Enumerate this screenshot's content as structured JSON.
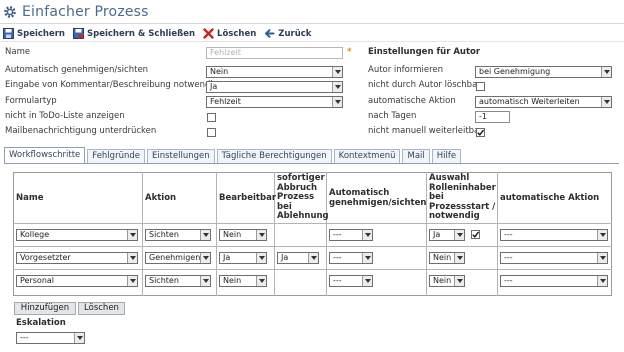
{
  "window": {
    "title": "Einfacher Prozess"
  },
  "toolbar": {
    "save": "Speichern",
    "save_close": "Speichern & Schließen",
    "delete": "Löschen",
    "back": "Zurück"
  },
  "form": {
    "name_label": "Name",
    "name_placeholder": "Fehlzeit",
    "required_mark": "*",
    "auto_approve_label": "Automatisch genehmigen/sichten",
    "auto_approve_value": "Nein",
    "comment_label": "Eingabe von Kommentar/Beschreibung notwendig",
    "comment_value": "Ja",
    "formtype_label": "Formulartyp",
    "formtype_value": "Fehlzeit",
    "not_todo_label": "nicht in ToDo-Liste anzeigen",
    "mail_suppress_label": "Mailbenachrichtigung unterdrücken"
  },
  "author": {
    "heading": "Einstellungen für Autor",
    "inform_label": "Autor informieren",
    "inform_value": "bei Genehmigung",
    "not_deletable_label": "nicht durch Autor löschbar",
    "auto_action_label": "automatische Aktion",
    "auto_action_value": "automatisch Weiterleiten",
    "after_days_label": "nach Tagen",
    "after_days_value": "-1",
    "not_manual_label": "nicht manuell weiterleitbar"
  },
  "tabs": [
    "Workflowschritte",
    "Fehlgründe",
    "Einstellungen",
    "Tägliche Berechtigungen",
    "Kontextmenü",
    "Mail",
    "Hilfe"
  ],
  "table": {
    "headers": {
      "name": "Name",
      "action": "Aktion",
      "editable": "Bearbeitbar",
      "abort": [
        "sofortiger",
        "Abbruch",
        "Prozess",
        "bei",
        "Ablehnung"
      ],
      "auto": [
        "Automatisch",
        "genehmigen/sichten"
      ],
      "role": [
        "Auswahl",
        "Rolleninhaber",
        "bei",
        "Prozessstart /",
        "notwendig"
      ],
      "auto_action": "automatische Aktion"
    },
    "rows": [
      {
        "name": "Kollege",
        "action": "Sichten",
        "editable": "Nein",
        "abort": "",
        "auto": "---",
        "role": "Ja",
        "auto_action": "---"
      },
      {
        "name": "Vorgesetzter",
        "action": "Genehmigen",
        "editable": "Ja",
        "abort": "Ja",
        "auto": "---",
        "role": "Nein",
        "auto_action": "---"
      },
      {
        "name": "Personal",
        "action": "Sichten",
        "editable": "Nein",
        "abort": "",
        "auto": "---",
        "role": "Nein",
        "auto_action": "---"
      }
    ]
  },
  "buttons": {
    "add": "Hinzufügen",
    "delete": "Löschen"
  },
  "escalation": {
    "label": "Eskalation",
    "value": "---"
  },
  "colors": {
    "title": "#4a6a8f",
    "tab_border": "#8e9fb2",
    "required": "#e08a1e",
    "delete_icon": "#cc2222"
  }
}
